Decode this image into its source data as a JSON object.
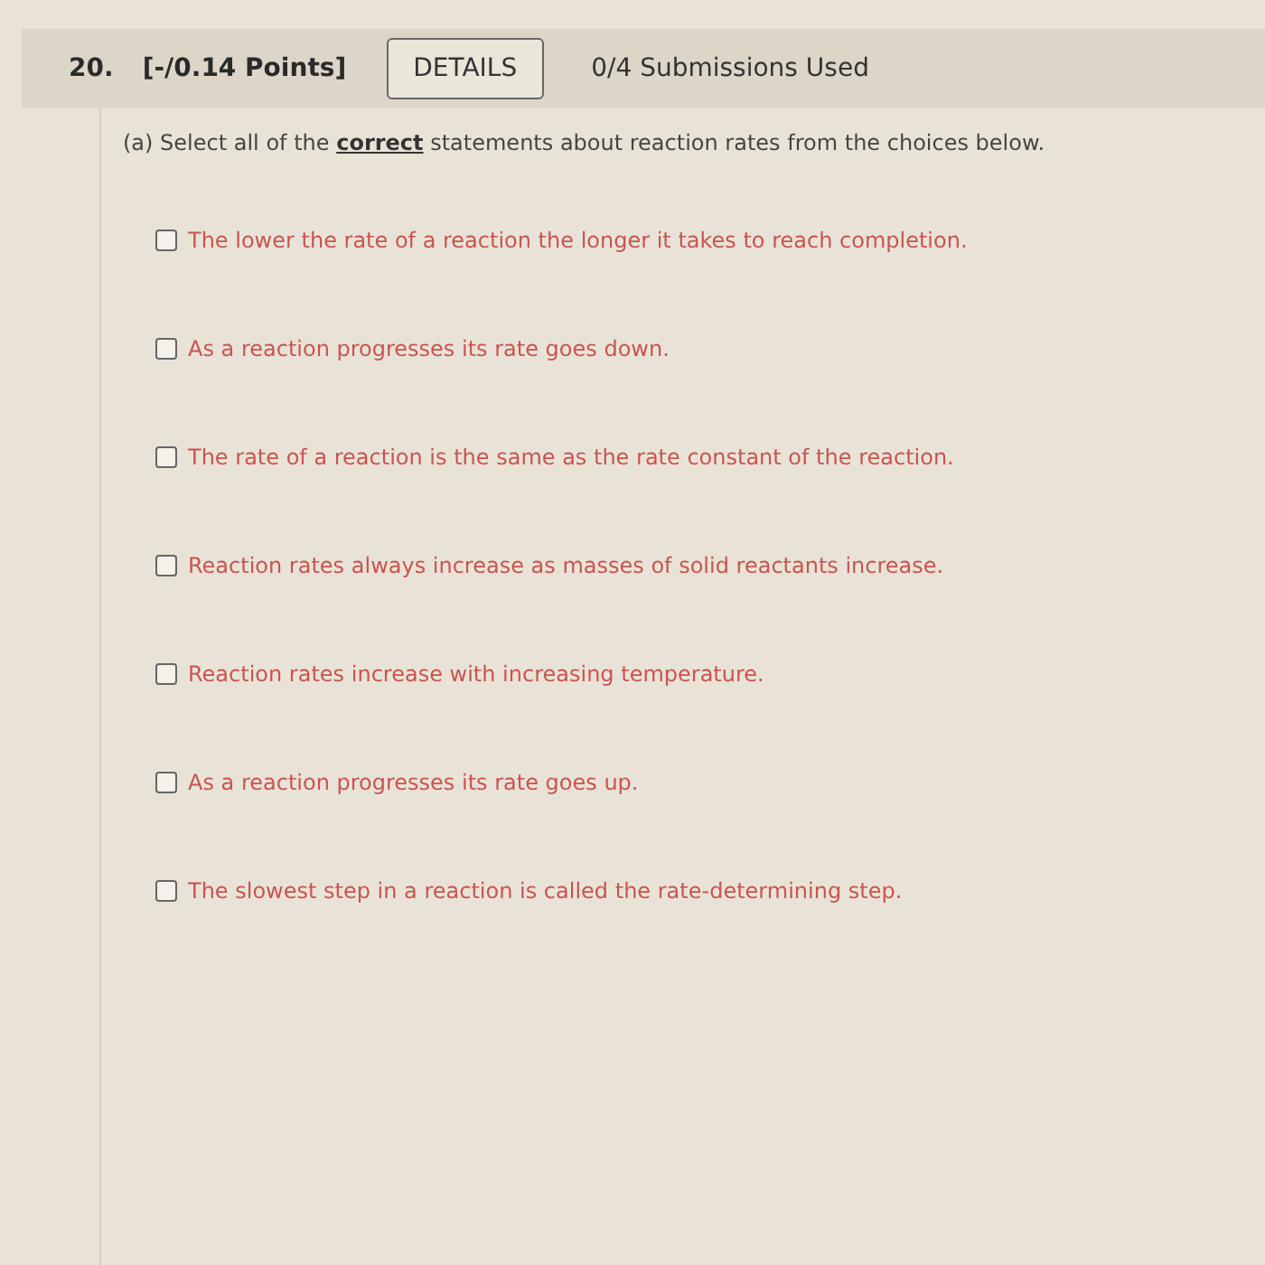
{
  "header": {
    "number": "20.",
    "points": "[-/0.14 Points]",
    "details_button": "DETAILS",
    "submissions": "0/4 Submissions Used"
  },
  "question": {
    "prompt": "(a) Select all of the **correct** statements about reaction rates from the choices below."
  },
  "choices": [
    {
      "label": "The lower the rate of a reaction the longer it takes to reach completion.",
      "checked": false
    },
    {
      "label": "As a reaction progresses its rate goes down.",
      "checked": false
    },
    {
      "label": "The rate of a reaction is the same as the rate constant of the reaction.",
      "checked": false
    },
    {
      "label": "Reaction rates always increase as masses of solid reactants increase.",
      "checked": false
    },
    {
      "label": "Reaction rates increase with increasing temperature.",
      "checked": false
    },
    {
      "label": "As a reaction progresses its rate goes up.",
      "checked": false
    },
    {
      "label": "The slowest step in a reaction is called the rate-determining step.",
      "checked": false
    }
  ]
}
